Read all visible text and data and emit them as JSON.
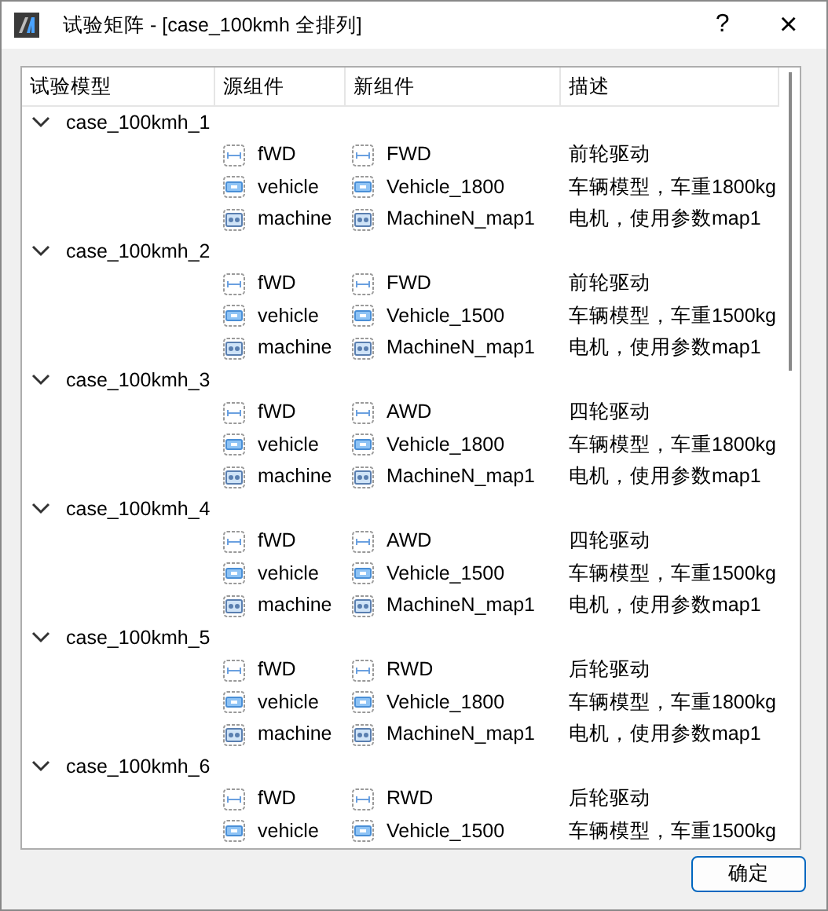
{
  "window": {
    "title": "试验矩阵 - [case_100kmh 全排列]",
    "help": "?",
    "close": "×"
  },
  "tree": {
    "columns": [
      "试验模型",
      "源组件",
      "新组件",
      "描述"
    ],
    "cases": [
      {
        "name": "case_100kmh_1",
        "expanded": true,
        "children": [
          {
            "kind": "drive",
            "source": "fWD",
            "target": "FWD",
            "description": "前轮驱动"
          },
          {
            "kind": "vehicle",
            "source": "vehicle",
            "target": "Vehicle_1800",
            "description": "车辆模型，车重1800kg"
          },
          {
            "kind": "motor",
            "source": "machine",
            "target": "MachineN_map1",
            "description": "电机，使用参数map1"
          }
        ]
      },
      {
        "name": "case_100kmh_2",
        "expanded": true,
        "children": [
          {
            "kind": "drive",
            "source": "fWD",
            "target": "FWD",
            "description": "前轮驱动"
          },
          {
            "kind": "vehicle",
            "source": "vehicle",
            "target": "Vehicle_1500",
            "description": "车辆模型，车重1500kg"
          },
          {
            "kind": "motor",
            "source": "machine",
            "target": "MachineN_map1",
            "description": "电机，使用参数map1"
          }
        ]
      },
      {
        "name": "case_100kmh_3",
        "expanded": true,
        "children": [
          {
            "kind": "drive",
            "source": "fWD",
            "target": "AWD",
            "description": "四轮驱动"
          },
          {
            "kind": "vehicle",
            "source": "vehicle",
            "target": "Vehicle_1800",
            "description": "车辆模型，车重1800kg"
          },
          {
            "kind": "motor",
            "source": "machine",
            "target": "MachineN_map1",
            "description": "电机，使用参数map1"
          }
        ]
      },
      {
        "name": "case_100kmh_4",
        "expanded": true,
        "children": [
          {
            "kind": "drive",
            "source": "fWD",
            "target": "AWD",
            "description": "四轮驱动"
          },
          {
            "kind": "vehicle",
            "source": "vehicle",
            "target": "Vehicle_1500",
            "description": "车辆模型，车重1500kg"
          },
          {
            "kind": "motor",
            "source": "machine",
            "target": "MachineN_map1",
            "description": "电机，使用参数map1"
          }
        ]
      },
      {
        "name": "case_100kmh_5",
        "expanded": true,
        "children": [
          {
            "kind": "drive",
            "source": "fWD",
            "target": "RWD",
            "description": "后轮驱动"
          },
          {
            "kind": "vehicle",
            "source": "vehicle",
            "target": "Vehicle_1800",
            "description": "车辆模型，车重1800kg"
          },
          {
            "kind": "motor",
            "source": "machine",
            "target": "MachineN_map1",
            "description": "电机，使用参数map1"
          }
        ]
      },
      {
        "name": "case_100kmh_6",
        "expanded": true,
        "children": [
          {
            "kind": "drive",
            "source": "fWD",
            "target": "RWD",
            "description": "后轮驱动"
          },
          {
            "kind": "vehicle",
            "source": "vehicle",
            "target": "Vehicle_1500",
            "description": "车辆模型，车重1500kg"
          }
        ]
      }
    ]
  },
  "buttons": [
    {
      "label": "确定",
      "default": true
    }
  ]
}
